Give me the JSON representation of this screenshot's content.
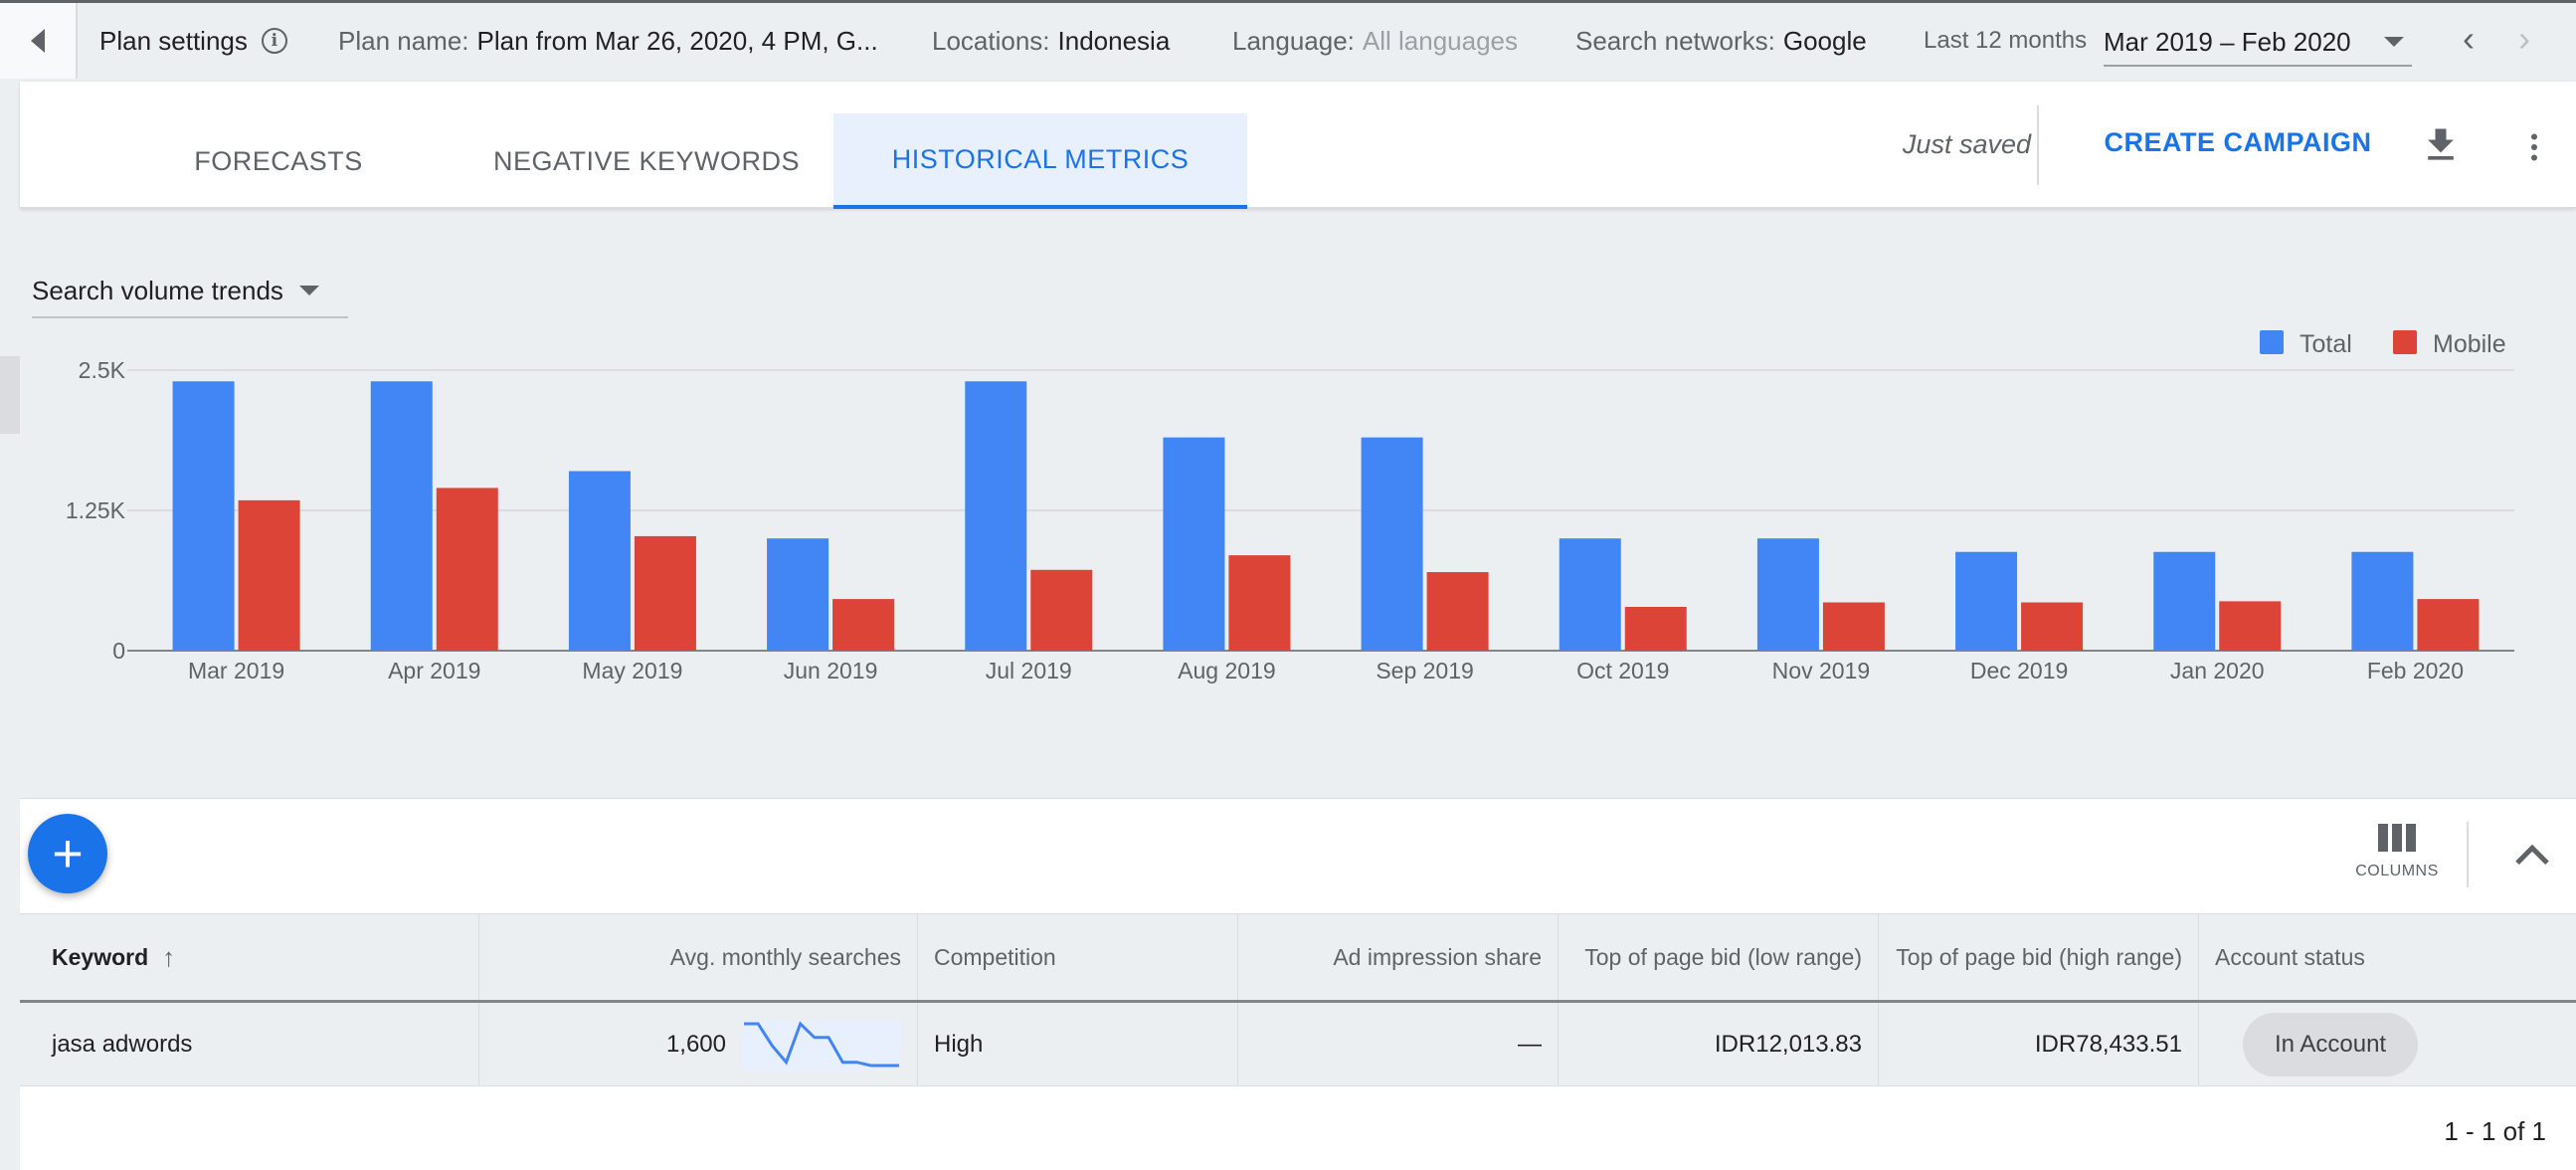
{
  "topbar": {
    "plan_settings_label": "Plan settings",
    "plan_name_label": "Plan name:",
    "plan_name_value": "Plan from Mar 26, 2020, 4 PM, G...",
    "locations_label": "Locations:",
    "locations_value": "Indonesia",
    "language_label": "Language:",
    "language_value": "All languages",
    "networks_label": "Search networks:",
    "networks_value": "Google",
    "range_label": "Last 12 months",
    "range_value": "Mar 2019 – Feb 2020"
  },
  "tabs": [
    {
      "label": "FORECASTS",
      "active": false
    },
    {
      "label": "NEGATIVE KEYWORDS",
      "active": false
    },
    {
      "label": "HISTORICAL METRICS",
      "active": true
    }
  ],
  "header_actions": {
    "status": "Just saved",
    "create_campaign": "CREATE CAMPAIGN"
  },
  "chart_selector": "Search volume trends",
  "chart_data": {
    "type": "bar",
    "categories": [
      "Mar 2019",
      "Apr 2019",
      "May 2019",
      "Jun 2019",
      "Jul 2019",
      "Aug 2019",
      "Sep 2019",
      "Oct 2019",
      "Nov 2019",
      "Dec 2019",
      "Jan 2020",
      "Feb 2020"
    ],
    "series": [
      {
        "name": "Total",
        "color": "#4285f4",
        "values": [
          2400,
          2400,
          1600,
          1000,
          2400,
          1900,
          1900,
          1000,
          1000,
          880,
          880,
          880
        ]
      },
      {
        "name": "Mobile",
        "color": "#db4437",
        "values": [
          1340,
          1450,
          1020,
          460,
          720,
          850,
          700,
          390,
          430,
          430,
          440,
          460
        ]
      }
    ],
    "yticks": [
      "0",
      "1.25K",
      "2.5K"
    ],
    "ylim": [
      0,
      2500
    ],
    "legend": "top-right",
    "grid": true
  },
  "toolbar": {
    "add_label": "+",
    "columns_label": "COLUMNS"
  },
  "table": {
    "headers": {
      "keyword": "Keyword",
      "avg_searches": "Avg. monthly searches",
      "competition": "Competition",
      "impression_share": "Ad impression share",
      "bid_low": "Top of page bid (low range)",
      "bid_high": "Top of page bid (high range)",
      "account_status": "Account status"
    },
    "rows": [
      {
        "keyword": "jasa adwords",
        "avg_searches": "1,600",
        "competition": "High",
        "impression_share": "—",
        "bid_low": "IDR12,013.83",
        "bid_high": "IDR78,433.51",
        "account_status": "In Account"
      }
    ]
  },
  "pagination": "1 - 1 of 1"
}
